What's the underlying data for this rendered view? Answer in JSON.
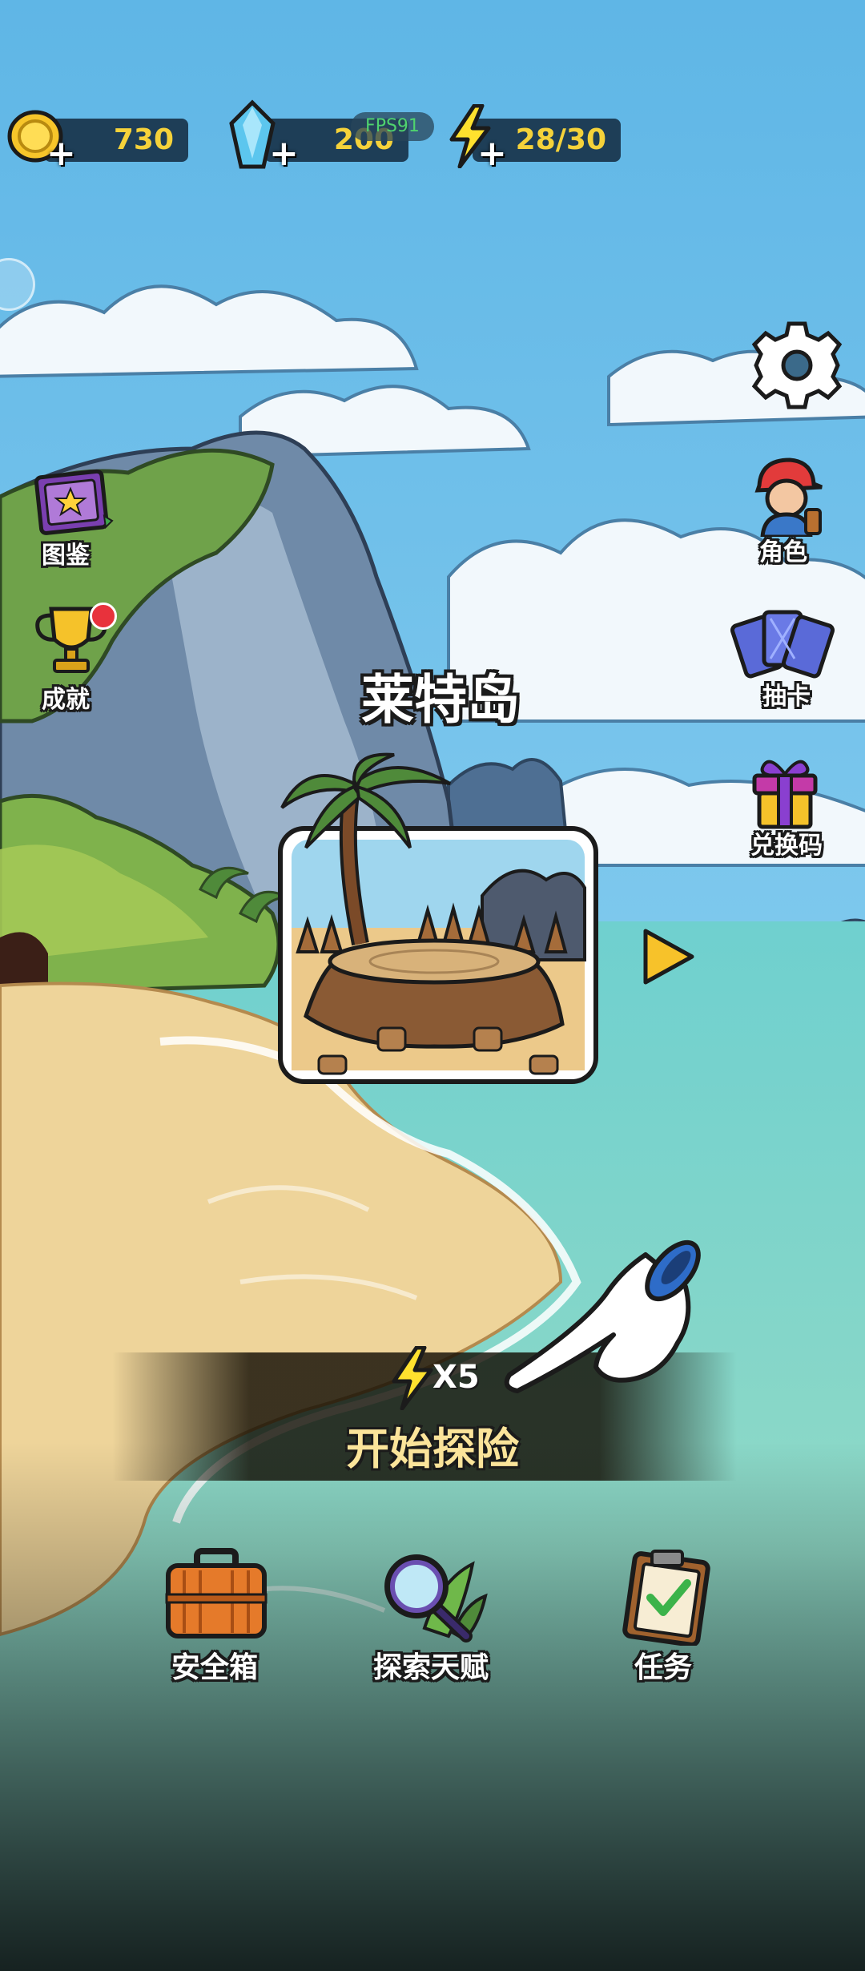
{
  "resources": {
    "coins": "730",
    "gems": "200",
    "energy": "28/30",
    "fps": "FPS91"
  },
  "left_menu": {
    "codex": "图鉴",
    "achievements": "成就"
  },
  "right_menu": {
    "character": "角色",
    "draw_cards": "抽卡",
    "redeem_code": "兑换码"
  },
  "stage": {
    "name": "莱特岛"
  },
  "start": {
    "cost": "X5",
    "label": "开始探险"
  },
  "bottom_menu": {
    "safe_box": "安全箱",
    "talents": "探索天赋",
    "tasks": "任务"
  },
  "colors": {
    "sky": "#7ec8ee",
    "sea": "#5fc4c0",
    "sand": "#edd29a",
    "gold_text": "#f5d23a",
    "badge_red": "#e8323c"
  }
}
